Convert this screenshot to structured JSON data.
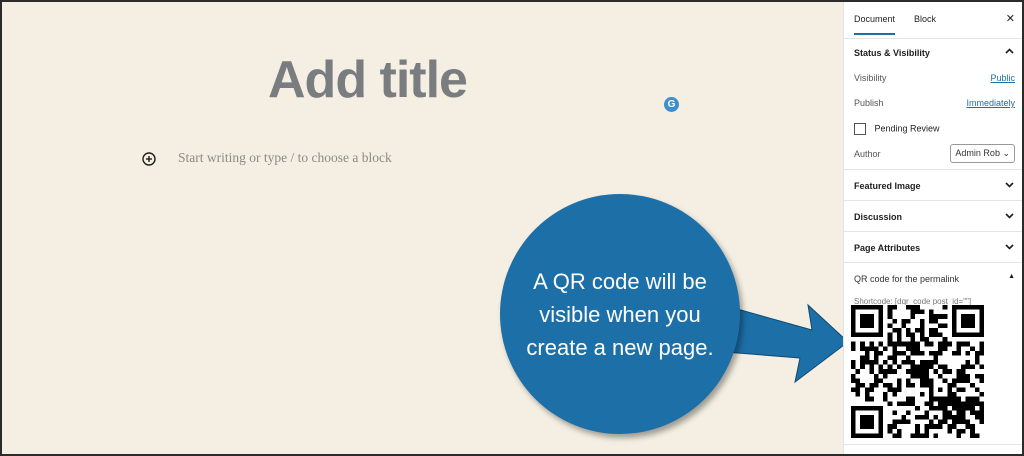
{
  "editor": {
    "title_placeholder": "Add title",
    "body_placeholder": "Start writing or type / to choose a block",
    "grammarly_letter": "G"
  },
  "callout": {
    "text": "A QR code will be visible when you create a new page.",
    "color": "#1d6fa8"
  },
  "sidebar": {
    "tabs": [
      "Document",
      "Block"
    ],
    "close_icon": "close-icon",
    "status_panel": {
      "title": "Status & Visibility",
      "visibility_label": "Visibility",
      "visibility_value": "Public",
      "publish_label": "Publish",
      "publish_value": "Immediately",
      "pending_review_label": "Pending Review",
      "author_label": "Author",
      "author_value": "Admin Rob"
    },
    "panels": [
      "Featured Image",
      "Discussion",
      "Page Attributes",
      "QR code for the permalink"
    ],
    "shortcode": "Shortcode: [dqr_code post_id=\"\"]"
  }
}
